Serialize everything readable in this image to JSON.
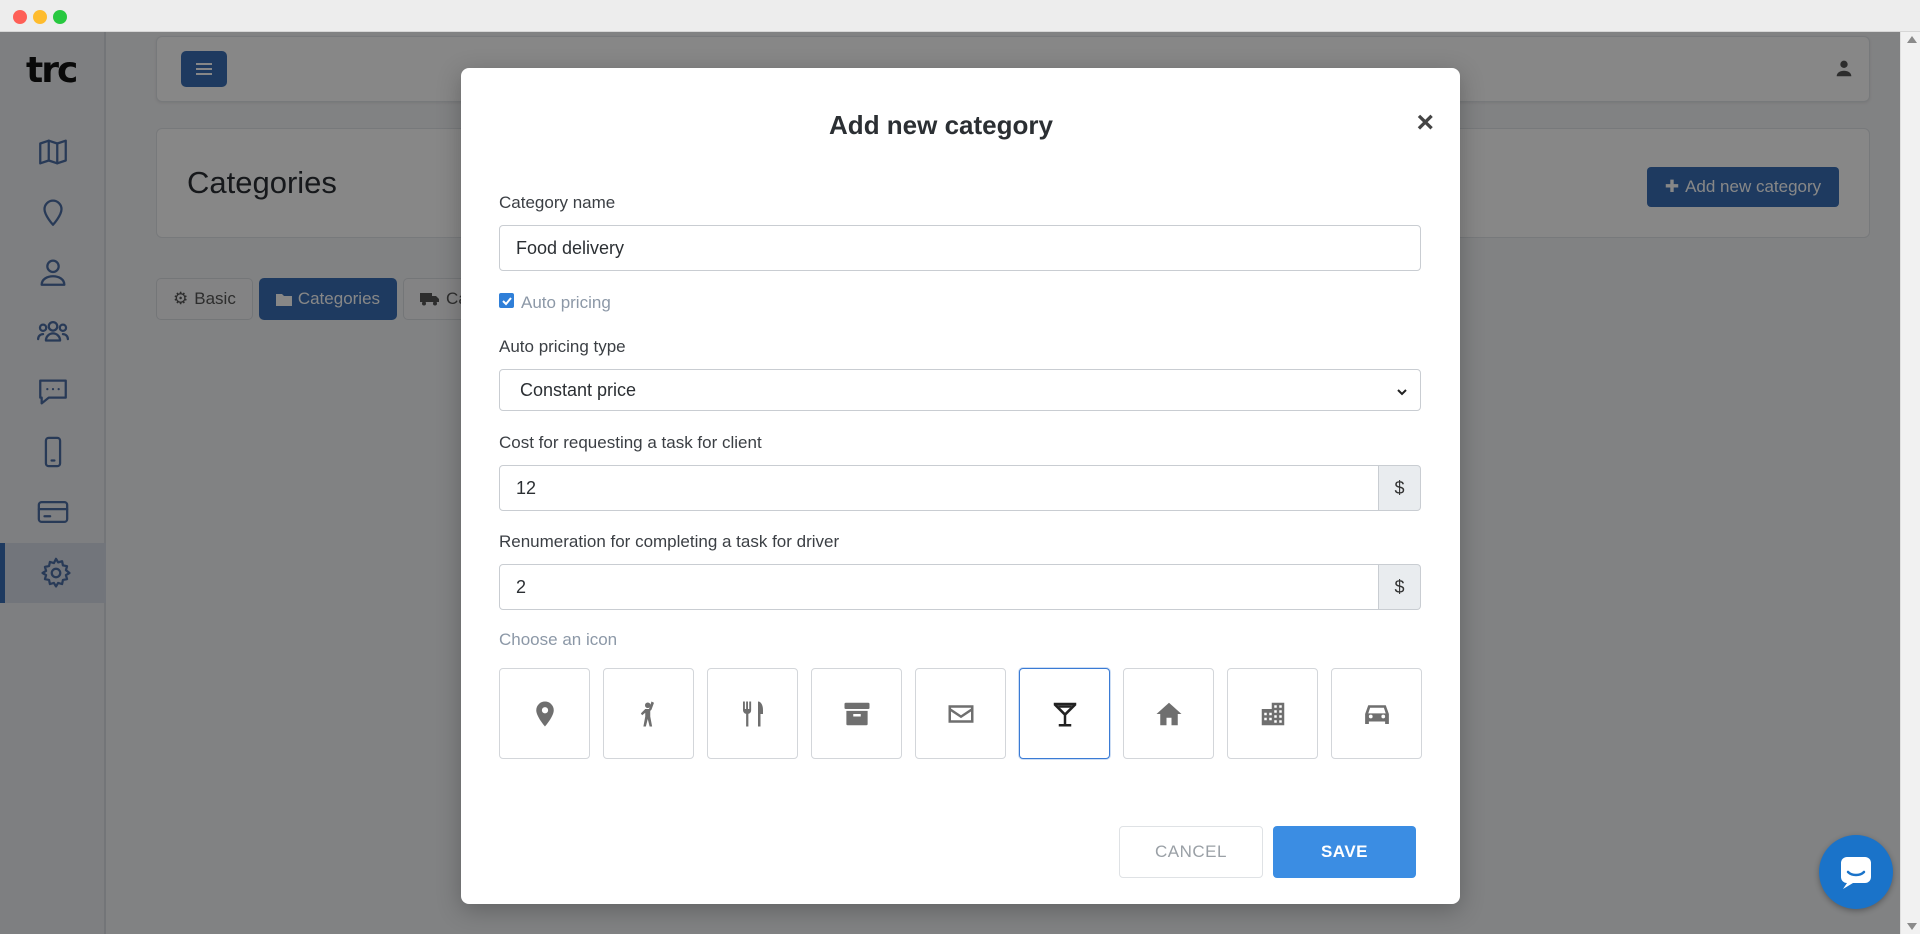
{
  "app": {
    "logo_text": "trc",
    "sidebar": {
      "items": [
        {
          "name": "map",
          "icon": "map-icon"
        },
        {
          "name": "location",
          "icon": "location-pin-icon"
        },
        {
          "name": "user",
          "icon": "user-icon"
        },
        {
          "name": "users",
          "icon": "users-icon"
        },
        {
          "name": "messages",
          "icon": "chat-icon"
        },
        {
          "name": "mobile",
          "icon": "mobile-icon"
        },
        {
          "name": "billing",
          "icon": "credit-card-icon"
        },
        {
          "name": "settings",
          "icon": "gear-icon",
          "active": true
        }
      ]
    },
    "page_title": "Categories",
    "add_button_label": "Add new category",
    "tabs": [
      {
        "label": "Basic",
        "icon": "gear-icon"
      },
      {
        "label": "Categories",
        "icon": "folder-icon",
        "active": true
      },
      {
        "label": "Ca",
        "icon": "truck-icon"
      }
    ]
  },
  "modal": {
    "title": "Add new category",
    "category_name_label": "Category name",
    "category_name_value": "Food delivery",
    "auto_pricing_label": "Auto pricing",
    "auto_pricing_checked": true,
    "auto_pricing_type_label": "Auto pricing type",
    "auto_pricing_type_value": "Constant price",
    "cost_label": "Cost for requesting a task for client",
    "cost_value": "12",
    "cost_currency": "$",
    "renumeration_label": "Renumeration for completing a task for driver",
    "renumeration_value": "2",
    "renumeration_currency": "$",
    "icon_label": "Choose an icon",
    "icons": [
      "map-marker-icon",
      "person-hailing-icon",
      "utensils-icon",
      "archive-box-icon",
      "envelope-icon",
      "cocktail-icon",
      "home-icon",
      "building-icon",
      "car-icon"
    ],
    "selected_icon": "cocktail-icon",
    "cancel_label": "CANCEL",
    "save_label": "SAVE"
  },
  "colors": {
    "primary": "#3a6fb5",
    "save": "#3b8de3",
    "checkbox": "#2f7fd8",
    "chat": "#1a73c9"
  }
}
